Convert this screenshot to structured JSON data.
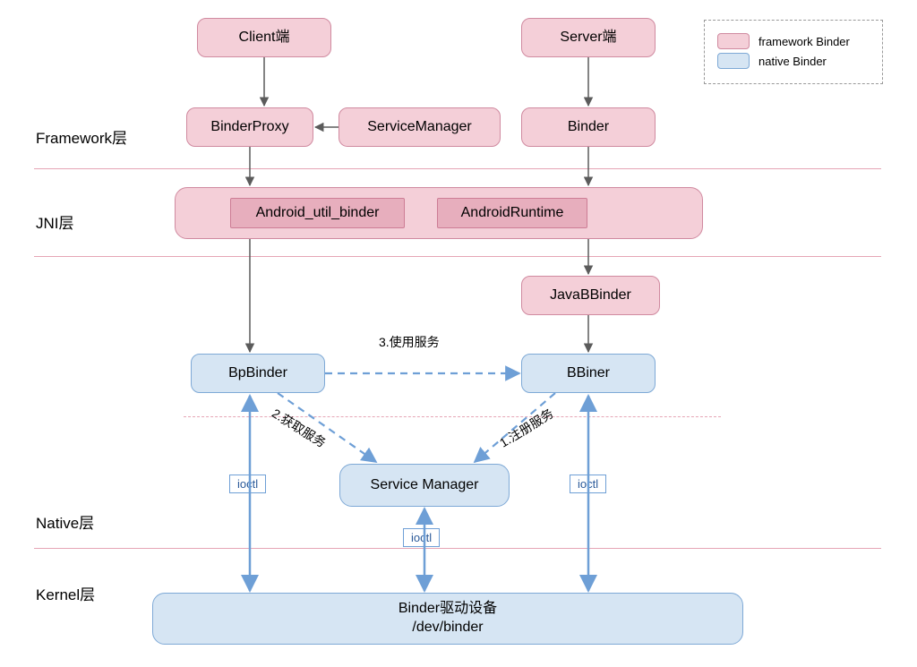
{
  "layers": {
    "framework": "Framework层",
    "jni": "JNI层",
    "native": "Native层",
    "kernel": "Kernel层"
  },
  "legend": {
    "framework": "framework Binder",
    "native": "native Binder"
  },
  "nodes": {
    "client": "Client端",
    "server": "Server端",
    "binderProxy": "BinderProxy",
    "serviceManagerFw": "ServiceManager",
    "binder": "Binder",
    "jniWide": "",
    "androidUtilBinder": "Android_util_binder",
    "androidRuntime": "AndroidRuntime",
    "javaBBinder": "JavaBBinder",
    "bpBinder": "BpBinder",
    "bBiner": "BBiner",
    "serviceManagerNative": "Service Manager",
    "binderDriver": "Binder驱动设备\n/dev/binder"
  },
  "labels": {
    "useService": "3.使用服务",
    "getService": "2.获取服务",
    "registerService": "1.注册服务",
    "ioctl": "ioctl"
  },
  "colors": {
    "pink": "#f4cfd8",
    "pinkBorder": "#d08aa0",
    "blue": "#d6e5f3",
    "blueBorder": "#7ea9d6",
    "arrowGray": "#5b5b5b",
    "arrowBlue": "#6e9fd6"
  }
}
